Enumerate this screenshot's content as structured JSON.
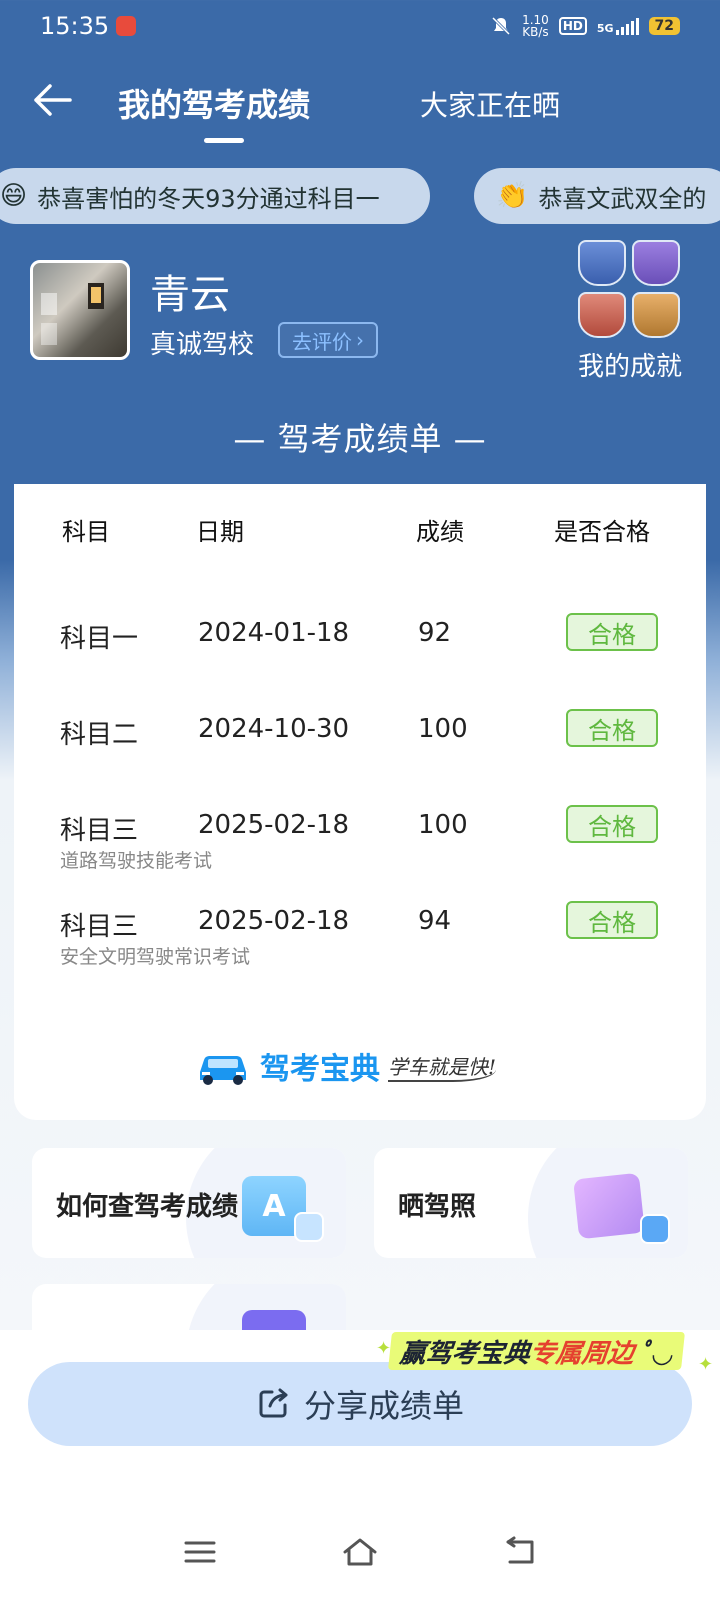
{
  "status_bar": {
    "time": "15:35",
    "net_speed_top": "1.10",
    "net_speed_bottom": "KB/s",
    "hd": "HD",
    "net_type": "5G",
    "battery": "72"
  },
  "header": {
    "title": "我的驾考成绩",
    "other_tab": "大家正在晒"
  },
  "ticker": [
    {
      "emoji": "😄",
      "text": "恭喜害怕的冬天93分通过科目一"
    },
    {
      "emoji": "👏",
      "text": "恭喜文武双全的"
    }
  ],
  "profile": {
    "name": "青云",
    "school": "真诚驾校",
    "rate_label": "去评价",
    "achievements_label": "我的成就"
  },
  "section_title": "— 驾考成绩单 —",
  "table": {
    "headers": [
      "科目",
      "日期",
      "成绩",
      "是否合格"
    ],
    "rows": [
      {
        "subject": "科目一",
        "date": "2024-01-18",
        "score": "92",
        "result": "合格",
        "note": ""
      },
      {
        "subject": "科目二",
        "date": "2024-10-30",
        "score": "100",
        "result": "合格",
        "note": ""
      },
      {
        "subject": "科目三",
        "date": "2025-02-18",
        "score": "100",
        "result": "合格",
        "note": "道路驾驶技能考试"
      },
      {
        "subject": "科目三",
        "date": "2025-02-18",
        "score": "94",
        "result": "合格",
        "note": "安全文明驾驶常识考试"
      }
    ]
  },
  "brand": {
    "name": "驾考宝典",
    "slogan": "学车就是快!"
  },
  "features": [
    {
      "label": "如何查驾考成绩",
      "icon_letter": "A"
    },
    {
      "label": "晒驾照"
    },
    {
      "label": ""
    }
  ],
  "promo": {
    "part1": "赢驾考宝典",
    "part2": "专属周边"
  },
  "share_button": {
    "label": "分享成绩单"
  },
  "colors": {
    "primary": "#3b6aa8",
    "pass": "#5fb83f",
    "brand": "#1b96f0",
    "share_bg": "#cfe2fb"
  }
}
